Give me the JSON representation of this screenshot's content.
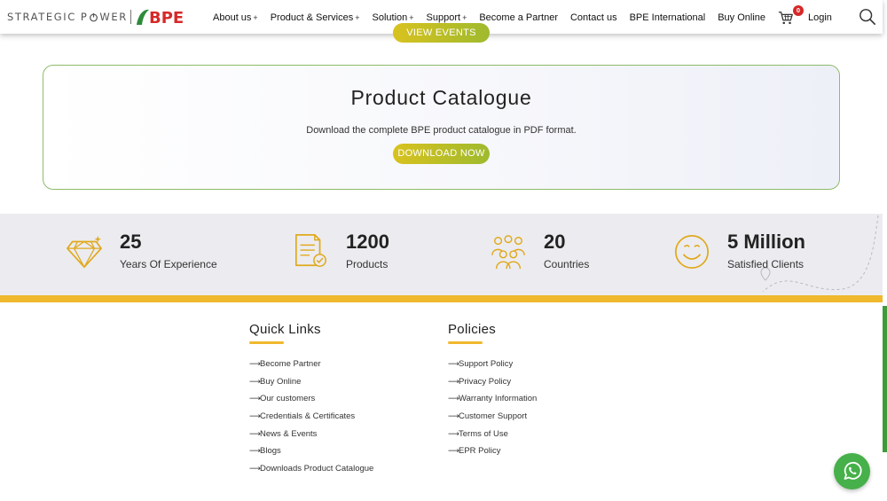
{
  "header": {
    "logo": {
      "text_left": "STRATEGIC",
      "text_right": "P",
      "text_right_rest": "WER",
      "brand": "BPE"
    },
    "nav": [
      {
        "label": "About us",
        "has_plus": true
      },
      {
        "label": "Product & Services",
        "has_plus": true
      },
      {
        "label": "Solution",
        "has_plus": true
      },
      {
        "label": "Support",
        "has_plus": true
      },
      {
        "label": "Become a Partner",
        "has_plus": false
      },
      {
        "label": "Contact us",
        "has_plus": false
      },
      {
        "label": "BPE International",
        "has_plus": false
      },
      {
        "label": "Buy Online",
        "has_plus": false
      }
    ],
    "plus": "+",
    "cart_count": "0",
    "login": "Login",
    "icons": {
      "cart": "cart-icon",
      "search": "search-icon"
    }
  },
  "view_events": "VIEW EVENTS",
  "catalogue": {
    "title": "Product Catalogue",
    "description": "Download the complete BPE product catalogue in PDF format.",
    "button": "DOWNLOAD NOW"
  },
  "stats": [
    {
      "number": "25",
      "label": "Years Of Experience",
      "icon": "diamond-icon"
    },
    {
      "number": "1200",
      "label": "Products",
      "icon": "document-check-icon"
    },
    {
      "number": "20",
      "label": "Countries",
      "icon": "people-group-icon"
    },
    {
      "number": "5 Million",
      "label": "Satisfied Clients",
      "icon": "smiley-icon"
    }
  ],
  "footer": {
    "quick_links": {
      "heading": "Quick Links",
      "items": [
        "Become Partner",
        "Buy Online",
        "Our customers",
        "Credentials & Certificates",
        "News & Events",
        "Blogs",
        "Downloads Product Catalogue"
      ]
    },
    "policies": {
      "heading": "Policies",
      "items": [
        "Support Policy",
        "Privacy Policy",
        "Warranty Information",
        "Customer Support",
        "Terms of Use",
        "EPR Policy"
      ]
    }
  },
  "colors": {
    "accent_yellow": "#f0b82d",
    "button_gradient_start": "#d8c21f",
    "button_gradient_end": "#9fba2e",
    "brand_red": "#d62828",
    "whatsapp_green": "#46b04a"
  }
}
